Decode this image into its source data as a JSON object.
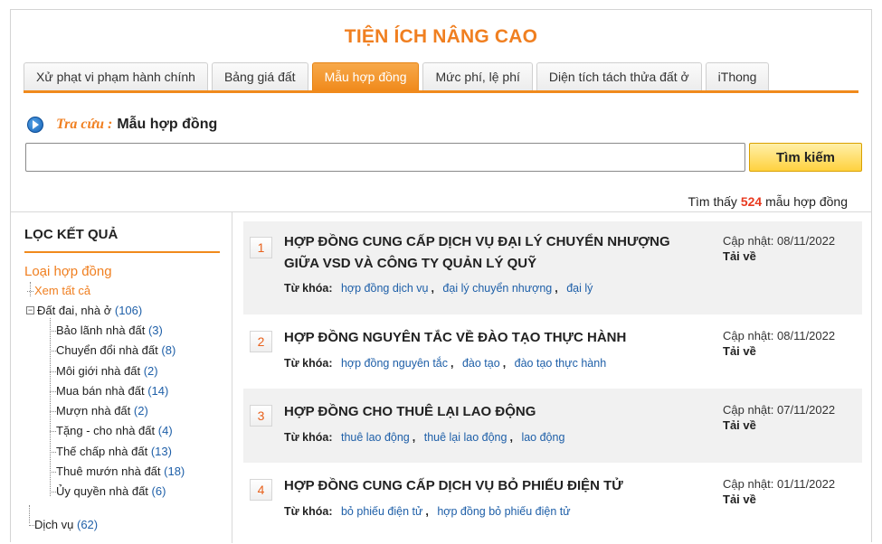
{
  "header": {
    "title": "TIỆN ÍCH NÂNG CAO"
  },
  "tabs": [
    {
      "label": "Xử phạt vi phạm hành chính",
      "active": false
    },
    {
      "label": "Bảng giá đất",
      "active": false
    },
    {
      "label": "Mẫu hợp đồng",
      "active": true
    },
    {
      "label": "Mức phí, lệ phí",
      "active": false
    },
    {
      "label": "Diện tích tách thửa đất ở",
      "active": false
    },
    {
      "label": "iThong",
      "active": false
    }
  ],
  "search": {
    "prefix": "Tra cứu :",
    "title": "Mẫu hợp đồng",
    "placeholder": "",
    "value": "",
    "button_label": "Tìm kiếm"
  },
  "result_summary": {
    "prefix": "Tìm thấy",
    "count": "524",
    "suffix": "mẫu hợp đồng"
  },
  "sidebar": {
    "title": "LỌC KẾT QUẢ",
    "filter_heading": "Loại hợp đồng",
    "view_all": "Xem tất cả",
    "root": {
      "label": "Đất đai, nhà ở",
      "count": "(106)",
      "toggle": "−"
    },
    "children": [
      {
        "label": "Bảo lãnh nhà đất",
        "count": "(3)"
      },
      {
        "label": "Chuyển đổi nhà đất",
        "count": "(8)"
      },
      {
        "label": "Môi giới nhà đất",
        "count": "(2)"
      },
      {
        "label": "Mua bán nhà đất",
        "count": "(14)"
      },
      {
        "label": "Mượn nhà đất",
        "count": "(2)"
      },
      {
        "label": "Tặng - cho nhà đất",
        "count": "(4)"
      },
      {
        "label": "Thế chấp nhà đất",
        "count": "(13)"
      },
      {
        "label": "Thuê mướn nhà đất",
        "count": "(18)"
      },
      {
        "label": "Ủy quyền nhà đất",
        "count": "(6)"
      }
    ],
    "root2": {
      "label": "Dịch vụ",
      "count": "(62)"
    }
  },
  "results": {
    "keyword_label": "Từ khóa:",
    "updated_label": "Cập nhật:",
    "download_label": "Tải về",
    "items": [
      {
        "num": "1",
        "title": "HỢP ĐỒNG CUNG CẤP DỊCH VỤ ĐẠI LÝ CHUYỂN NHƯỢNG GIỮA VSD VÀ CÔNG TY QUẢN LÝ QUỸ",
        "keywords": [
          "hợp đồng dịch vụ",
          "đại lý chuyển nhượng",
          "đại lý"
        ],
        "date": "08/11/2022"
      },
      {
        "num": "2",
        "title": "HỢP ĐỒNG NGUYÊN TẮC VỀ ĐÀO TẠO THỰC HÀNH",
        "keywords": [
          "hợp đồng nguyên tắc",
          "đào tạo",
          "đào tạo thực hành"
        ],
        "date": "08/11/2022"
      },
      {
        "num": "3",
        "title": "HỢP ĐỒNG CHO THUÊ LẠI LAO ĐỘNG",
        "keywords": [
          "thuê lao động",
          "thuê lại lao động",
          "lao động"
        ],
        "date": "07/11/2022"
      },
      {
        "num": "4",
        "title": "HỢP ĐỒNG CUNG CẤP DỊCH VỤ BỎ PHIẾU ĐIỆN TỬ",
        "keywords": [
          "bỏ phiếu điện tử",
          "hợp đồng bỏ phiếu điện tử"
        ],
        "date": "01/11/2022"
      }
    ]
  }
}
